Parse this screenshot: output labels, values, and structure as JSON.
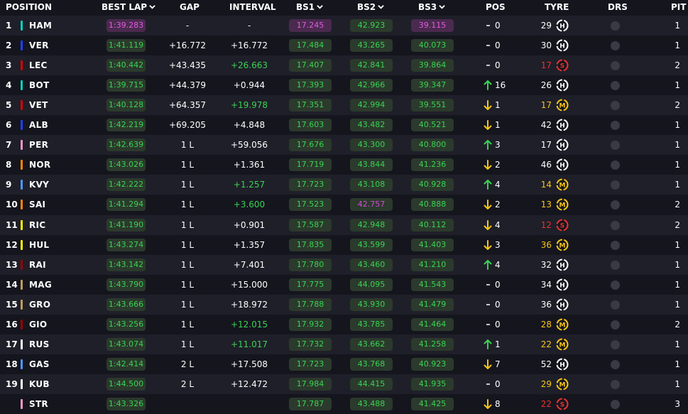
{
  "header": {
    "position": "POSITION",
    "best_lap": "BEST LAP",
    "gap": "GAP",
    "interval": "INTERVAL",
    "bs1": "BS1",
    "bs2": "BS2",
    "bs3": "BS3",
    "pos": "POS",
    "tyre": "TYRE",
    "drs": "DRS",
    "pit": "PIT"
  },
  "colors": {
    "background": "#15151e",
    "row_alt": "#1f1f29",
    "green": "#39d353",
    "purple": "#e25ce4",
    "red": "#e8312f",
    "yellow": "#f5c518"
  },
  "rows": [
    {
      "pos": "1",
      "driver": "HAM",
      "team_color": "#00d2be",
      "best_lap": "1:39.283",
      "best_lap_style": "best",
      "gap": "-",
      "interval": "-",
      "interval_style": "white",
      "bs1": "17.245",
      "bs1_style": "best",
      "bs2": "42.923",
      "bs2_style": "green",
      "bs3": "39.115",
      "bs3_style": "best",
      "pos_change_dir": "none",
      "pos_change": "0",
      "tyre_age": "29",
      "tyre_compound": "H",
      "tyre_style": "white",
      "pit": "1"
    },
    {
      "pos": "2",
      "driver": "VER",
      "team_color": "#1e41ff",
      "best_lap": "1:41.119",
      "best_lap_style": "green",
      "gap": "+16.772",
      "interval": "+16.772",
      "interval_style": "white",
      "bs1": "17.484",
      "bs1_style": "green",
      "bs2": "43.265",
      "bs2_style": "green",
      "bs3": "40.073",
      "bs3_style": "green",
      "pos_change_dir": "none",
      "pos_change": "0",
      "tyre_age": "30",
      "tyre_compound": "H",
      "tyre_style": "white",
      "pit": "1"
    },
    {
      "pos": "3",
      "driver": "LEC",
      "team_color": "#dc0000",
      "best_lap": "1:40.442",
      "best_lap_style": "green",
      "gap": "+43.435",
      "interval": "+26.663",
      "interval_style": "green",
      "bs1": "17.407",
      "bs1_style": "green",
      "bs2": "42.841",
      "bs2_style": "green",
      "bs3": "39.864",
      "bs3_style": "green",
      "pos_change_dir": "none",
      "pos_change": "0",
      "tyre_age": "17",
      "tyre_compound": "S",
      "tyre_style": "red",
      "pit": "2"
    },
    {
      "pos": "4",
      "driver": "BOT",
      "team_color": "#00d2be",
      "best_lap": "1:39.715",
      "best_lap_style": "green",
      "gap": "+44.379",
      "interval": "+0.944",
      "interval_style": "white",
      "bs1": "17.393",
      "bs1_style": "green",
      "bs2": "42.966",
      "bs2_style": "green",
      "bs3": "39.347",
      "bs3_style": "green",
      "pos_change_dir": "up",
      "pos_change": "16",
      "tyre_age": "26",
      "tyre_compound": "H",
      "tyre_style": "white",
      "pit": "1"
    },
    {
      "pos": "5",
      "driver": "VET",
      "team_color": "#dc0000",
      "best_lap": "1:40.128",
      "best_lap_style": "green",
      "gap": "+64.357",
      "interval": "+19.978",
      "interval_style": "green",
      "bs1": "17.351",
      "bs1_style": "green",
      "bs2": "42.994",
      "bs2_style": "green",
      "bs3": "39.551",
      "bs3_style": "green",
      "pos_change_dir": "down",
      "pos_change": "1",
      "tyre_age": "17",
      "tyre_compound": "M",
      "tyre_style": "yellow",
      "pit": "2"
    },
    {
      "pos": "6",
      "driver": "ALB",
      "team_color": "#1e41ff",
      "best_lap": "1:42.219",
      "best_lap_style": "green",
      "gap": "+69.205",
      "interval": "+4.848",
      "interval_style": "white",
      "bs1": "17.603",
      "bs1_style": "green",
      "bs2": "43.482",
      "bs2_style": "green",
      "bs3": "40.521",
      "bs3_style": "green",
      "pos_change_dir": "down",
      "pos_change": "1",
      "tyre_age": "42",
      "tyre_compound": "H",
      "tyre_style": "white",
      "pit": "1"
    },
    {
      "pos": "7",
      "driver": "PER",
      "team_color": "#f596c8",
      "best_lap": "1:42.639",
      "best_lap_style": "green",
      "gap": "1 L",
      "interval": "+59.056",
      "interval_style": "white",
      "bs1": "17.676",
      "bs1_style": "green",
      "bs2": "43.300",
      "bs2_style": "green",
      "bs3": "40.800",
      "bs3_style": "green",
      "pos_change_dir": "up",
      "pos_change": "3",
      "tyre_age": "17",
      "tyre_compound": "H",
      "tyre_style": "white",
      "pit": "1"
    },
    {
      "pos": "8",
      "driver": "NOR",
      "team_color": "#ff8700",
      "best_lap": "1:43.026",
      "best_lap_style": "green",
      "gap": "1 L",
      "interval": "+1.361",
      "interval_style": "white",
      "bs1": "17.719",
      "bs1_style": "green",
      "bs2": "43.844",
      "bs2_style": "green",
      "bs3": "41.236",
      "bs3_style": "green",
      "pos_change_dir": "down",
      "pos_change": "2",
      "tyre_age": "46",
      "tyre_compound": "H",
      "tyre_style": "white",
      "pit": "1"
    },
    {
      "pos": "9",
      "driver": "KVY",
      "team_color": "#469bff",
      "best_lap": "1:42.222",
      "best_lap_style": "green",
      "gap": "1 L",
      "interval": "+1.257",
      "interval_style": "green",
      "bs1": "17.723",
      "bs1_style": "green",
      "bs2": "43.108",
      "bs2_style": "green",
      "bs3": "40.928",
      "bs3_style": "green",
      "pos_change_dir": "up",
      "pos_change": "4",
      "tyre_age": "14",
      "tyre_compound": "M",
      "tyre_style": "yellow",
      "pit": "1"
    },
    {
      "pos": "10",
      "driver": "SAI",
      "team_color": "#ff8700",
      "best_lap": "1:41.294",
      "best_lap_style": "green",
      "gap": "1 L",
      "interval": "+3.600",
      "interval_style": "green",
      "bs1": "17.523",
      "bs1_style": "green",
      "bs2": "42.757",
      "bs2_style": "purple",
      "bs3": "40.888",
      "bs3_style": "green",
      "pos_change_dir": "down",
      "pos_change": "2",
      "tyre_age": "13",
      "tyre_compound": "M",
      "tyre_style": "yellow",
      "pit": "2"
    },
    {
      "pos": "11",
      "driver": "RIC",
      "team_color": "#fff500",
      "best_lap": "1:41.190",
      "best_lap_style": "green",
      "gap": "1 L",
      "interval": "+0.901",
      "interval_style": "white",
      "bs1": "17.587",
      "bs1_style": "green",
      "bs2": "42.948",
      "bs2_style": "green",
      "bs3": "40.112",
      "bs3_style": "green",
      "pos_change_dir": "down",
      "pos_change": "4",
      "tyre_age": "12",
      "tyre_compound": "S",
      "tyre_style": "red",
      "pit": "2"
    },
    {
      "pos": "12",
      "driver": "HUL",
      "team_color": "#fff500",
      "best_lap": "1:43.274",
      "best_lap_style": "green",
      "gap": "1 L",
      "interval": "+1.357",
      "interval_style": "white",
      "bs1": "17.835",
      "bs1_style": "green",
      "bs2": "43.599",
      "bs2_style": "green",
      "bs3": "41.403",
      "bs3_style": "green",
      "pos_change_dir": "down",
      "pos_change": "3",
      "tyre_age": "36",
      "tyre_compound": "M",
      "tyre_style": "yellow",
      "pit": "1"
    },
    {
      "pos": "13",
      "driver": "RAI",
      "team_color": "#9b0000",
      "best_lap": "1:43.142",
      "best_lap_style": "green",
      "gap": "1 L",
      "interval": "+7.401",
      "interval_style": "white",
      "bs1": "17.780",
      "bs1_style": "green",
      "bs2": "43.460",
      "bs2_style": "green",
      "bs3": "41.210",
      "bs3_style": "green",
      "pos_change_dir": "up",
      "pos_change": "4",
      "tyre_age": "32",
      "tyre_compound": "H",
      "tyre_style": "white",
      "pit": "1"
    },
    {
      "pos": "14",
      "driver": "MAG",
      "team_color": "#bd9e57",
      "best_lap": "1:43.790",
      "best_lap_style": "green",
      "gap": "1 L",
      "interval": "+15.000",
      "interval_style": "white",
      "bs1": "17.775",
      "bs1_style": "green",
      "bs2": "44.095",
      "bs2_style": "green",
      "bs3": "41.543",
      "bs3_style": "green",
      "pos_change_dir": "none",
      "pos_change": "0",
      "tyre_age": "34",
      "tyre_compound": "H",
      "tyre_style": "white",
      "pit": "1"
    },
    {
      "pos": "15",
      "driver": "GRO",
      "team_color": "#bd9e57",
      "best_lap": "1:43.666",
      "best_lap_style": "green",
      "gap": "1 L",
      "interval": "+18.972",
      "interval_style": "white",
      "bs1": "17.788",
      "bs1_style": "green",
      "bs2": "43.930",
      "bs2_style": "green",
      "bs3": "41.479",
      "bs3_style": "green",
      "pos_change_dir": "none",
      "pos_change": "0",
      "tyre_age": "36",
      "tyre_compound": "H",
      "tyre_style": "white",
      "pit": "1"
    },
    {
      "pos": "16",
      "driver": "GIO",
      "team_color": "#9b0000",
      "best_lap": "1:43.256",
      "best_lap_style": "green",
      "gap": "1 L",
      "interval": "+12.015",
      "interval_style": "green",
      "bs1": "17.932",
      "bs1_style": "green",
      "bs2": "43.785",
      "bs2_style": "green",
      "bs3": "41.464",
      "bs3_style": "green",
      "pos_change_dir": "none",
      "pos_change": "0",
      "tyre_age": "28",
      "tyre_compound": "M",
      "tyre_style": "yellow",
      "pit": "2"
    },
    {
      "pos": "17",
      "driver": "RUS",
      "team_color": "#ffffff",
      "best_lap": "1:43.074",
      "best_lap_style": "green",
      "gap": "1 L",
      "interval": "+11.017",
      "interval_style": "green",
      "bs1": "17.732",
      "bs1_style": "green",
      "bs2": "43.662",
      "bs2_style": "green",
      "bs3": "41.258",
      "bs3_style": "green",
      "pos_change_dir": "up",
      "pos_change": "1",
      "tyre_age": "22",
      "tyre_compound": "M",
      "tyre_style": "yellow",
      "pit": "1"
    },
    {
      "pos": "18",
      "driver": "GAS",
      "team_color": "#469bff",
      "best_lap": "1:42.414",
      "best_lap_style": "green",
      "gap": "2 L",
      "interval": "+17.508",
      "interval_style": "white",
      "bs1": "17.723",
      "bs1_style": "green",
      "bs2": "43.768",
      "bs2_style": "green",
      "bs3": "40.923",
      "bs3_style": "green",
      "pos_change_dir": "down",
      "pos_change": "7",
      "tyre_age": "52",
      "tyre_compound": "H",
      "tyre_style": "white",
      "pit": "1"
    },
    {
      "pos": "19",
      "driver": "KUB",
      "team_color": "#ffffff",
      "best_lap": "1:44.500",
      "best_lap_style": "green",
      "gap": "2 L",
      "interval": "+12.472",
      "interval_style": "white",
      "bs1": "17.984",
      "bs1_style": "green",
      "bs2": "44.415",
      "bs2_style": "green",
      "bs3": "41.935",
      "bs3_style": "green",
      "pos_change_dir": "none",
      "pos_change": "0",
      "tyre_age": "29",
      "tyre_compound": "M",
      "tyre_style": "yellow",
      "pit": "1"
    },
    {
      "pos": "",
      "driver": "STR",
      "team_color": "#f596c8",
      "best_lap": "1:43.326",
      "best_lap_style": "green",
      "gap": "",
      "interval": "",
      "interval_style": "white",
      "bs1": "17.787",
      "bs1_style": "green",
      "bs2": "43.488",
      "bs2_style": "green",
      "bs3": "41.425",
      "bs3_style": "green",
      "pos_change_dir": "down",
      "pos_change": "8",
      "tyre_age": "22",
      "tyre_compound": "S",
      "tyre_style": "red",
      "pit": "3"
    }
  ]
}
